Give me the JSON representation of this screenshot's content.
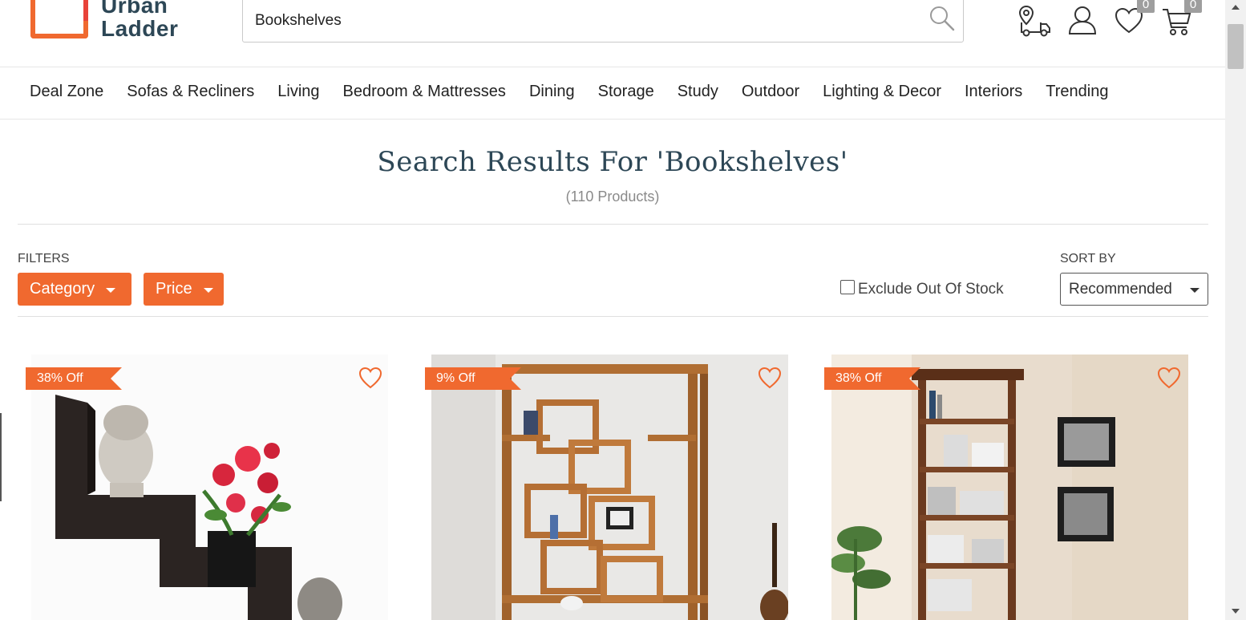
{
  "brand": {
    "name_line1": "Urban",
    "name_line2": "Ladder"
  },
  "search": {
    "value": "Bookshelves",
    "placeholder": ""
  },
  "header": {
    "wishlist_count": "0",
    "cart_count": "0"
  },
  "nav": {
    "items": [
      "Deal Zone",
      "Sofas & Recliners",
      "Living",
      "Bedroom & Mattresses",
      "Dining",
      "Storage",
      "Study",
      "Outdoor",
      "Lighting & Decor",
      "Interiors",
      "Trending"
    ]
  },
  "results": {
    "title": "Search Results For 'Bookshelves'",
    "count": "(110 Products)"
  },
  "filters": {
    "label": "FILTERS",
    "category_label": "Category",
    "price_label": "Price",
    "exclude_label": "Exclude Out Of Stock",
    "exclude_checked": false
  },
  "sort": {
    "label": "SORT BY",
    "selected": "Recommended"
  },
  "products": [
    {
      "discount": "38% Off"
    },
    {
      "discount": "9% Off"
    },
    {
      "discount": "38% Off"
    }
  ],
  "colors": {
    "accent": "#f0692f",
    "brand_text": "#2d4756",
    "badge": "#9e9e9e"
  }
}
